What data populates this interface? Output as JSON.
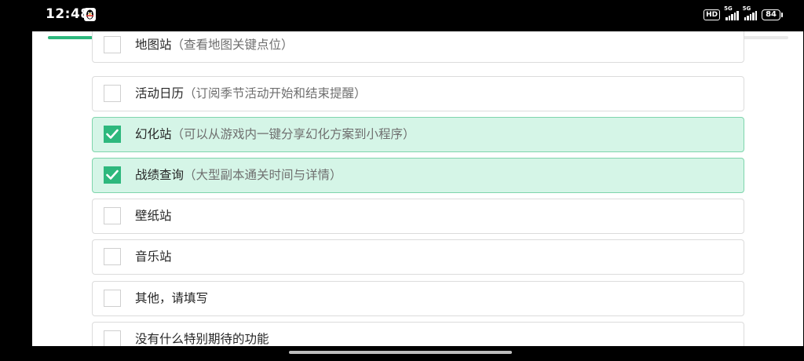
{
  "status_bar": {
    "time": "12:48",
    "hd_badge": "HD",
    "signal_1_label": "5G",
    "signal_2_label": "5G",
    "battery_level": "84",
    "app_icon": "qq-penguin-icon"
  },
  "survey": {
    "progress_fraction": 0.92,
    "accent_color": "#2db87d",
    "selected_bg_color": "#d5f5e7",
    "options": [
      {
        "label": "地图站",
        "note": "（查看地图关键点位）",
        "checked": false
      },
      {
        "label": "活动日历",
        "note": "（订阅季节活动开始和结束提醒）",
        "checked": false
      },
      {
        "label": "幻化站",
        "note": "（可以从游戏内一键分享幻化方案到小程序）",
        "checked": true
      },
      {
        "label": "战绩查询",
        "note": "（大型副本通关时间与详情）",
        "checked": true
      },
      {
        "label": "壁纸站",
        "note": "",
        "checked": false
      },
      {
        "label": "音乐站",
        "note": "",
        "checked": false
      },
      {
        "label": "其他，请填写",
        "note": "",
        "checked": false
      },
      {
        "label": "没有什么特别期待的功能",
        "note": "",
        "checked": false
      }
    ]
  }
}
